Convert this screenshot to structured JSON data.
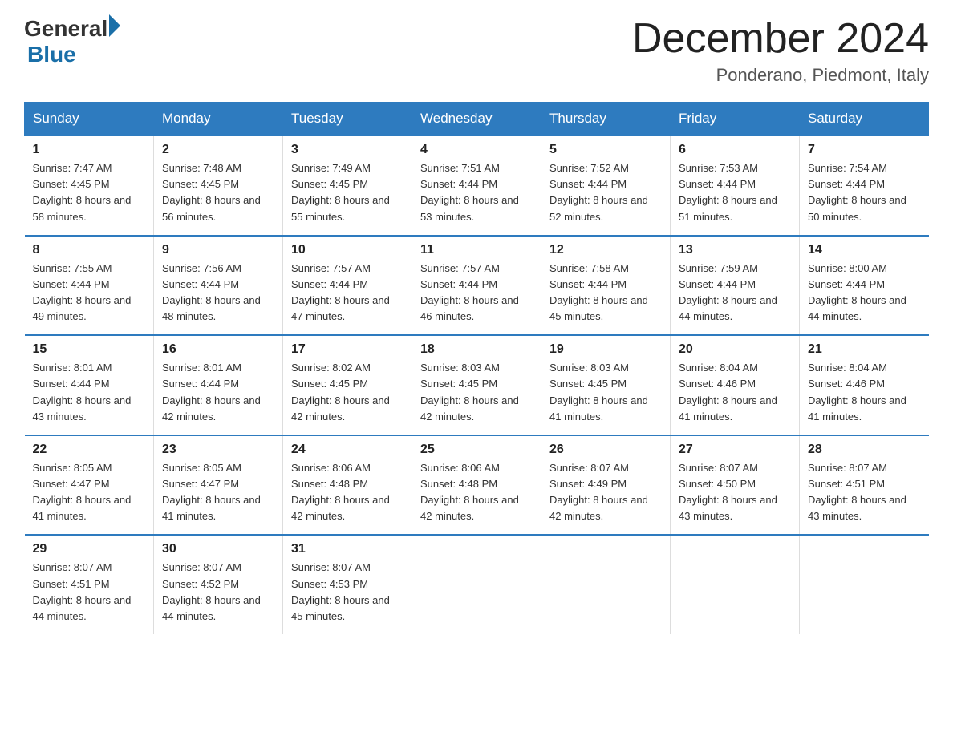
{
  "logo": {
    "general": "General",
    "blue": "Blue"
  },
  "title": "December 2024",
  "location": "Ponderano, Piedmont, Italy",
  "headers": [
    "Sunday",
    "Monday",
    "Tuesday",
    "Wednesday",
    "Thursday",
    "Friday",
    "Saturday"
  ],
  "weeks": [
    [
      {
        "day": "1",
        "sunrise": "7:47 AM",
        "sunset": "4:45 PM",
        "daylight": "8 hours and 58 minutes."
      },
      {
        "day": "2",
        "sunrise": "7:48 AM",
        "sunset": "4:45 PM",
        "daylight": "8 hours and 56 minutes."
      },
      {
        "day": "3",
        "sunrise": "7:49 AM",
        "sunset": "4:45 PM",
        "daylight": "8 hours and 55 minutes."
      },
      {
        "day": "4",
        "sunrise": "7:51 AM",
        "sunset": "4:44 PM",
        "daylight": "8 hours and 53 minutes."
      },
      {
        "day": "5",
        "sunrise": "7:52 AM",
        "sunset": "4:44 PM",
        "daylight": "8 hours and 52 minutes."
      },
      {
        "day": "6",
        "sunrise": "7:53 AM",
        "sunset": "4:44 PM",
        "daylight": "8 hours and 51 minutes."
      },
      {
        "day": "7",
        "sunrise": "7:54 AM",
        "sunset": "4:44 PM",
        "daylight": "8 hours and 50 minutes."
      }
    ],
    [
      {
        "day": "8",
        "sunrise": "7:55 AM",
        "sunset": "4:44 PM",
        "daylight": "8 hours and 49 minutes."
      },
      {
        "day": "9",
        "sunrise": "7:56 AM",
        "sunset": "4:44 PM",
        "daylight": "8 hours and 48 minutes."
      },
      {
        "day": "10",
        "sunrise": "7:57 AM",
        "sunset": "4:44 PM",
        "daylight": "8 hours and 47 minutes."
      },
      {
        "day": "11",
        "sunrise": "7:57 AM",
        "sunset": "4:44 PM",
        "daylight": "8 hours and 46 minutes."
      },
      {
        "day": "12",
        "sunrise": "7:58 AM",
        "sunset": "4:44 PM",
        "daylight": "8 hours and 45 minutes."
      },
      {
        "day": "13",
        "sunrise": "7:59 AM",
        "sunset": "4:44 PM",
        "daylight": "8 hours and 44 minutes."
      },
      {
        "day": "14",
        "sunrise": "8:00 AM",
        "sunset": "4:44 PM",
        "daylight": "8 hours and 44 minutes."
      }
    ],
    [
      {
        "day": "15",
        "sunrise": "8:01 AM",
        "sunset": "4:44 PM",
        "daylight": "8 hours and 43 minutes."
      },
      {
        "day": "16",
        "sunrise": "8:01 AM",
        "sunset": "4:44 PM",
        "daylight": "8 hours and 42 minutes."
      },
      {
        "day": "17",
        "sunrise": "8:02 AM",
        "sunset": "4:45 PM",
        "daylight": "8 hours and 42 minutes."
      },
      {
        "day": "18",
        "sunrise": "8:03 AM",
        "sunset": "4:45 PM",
        "daylight": "8 hours and 42 minutes."
      },
      {
        "day": "19",
        "sunrise": "8:03 AM",
        "sunset": "4:45 PM",
        "daylight": "8 hours and 41 minutes."
      },
      {
        "day": "20",
        "sunrise": "8:04 AM",
        "sunset": "4:46 PM",
        "daylight": "8 hours and 41 minutes."
      },
      {
        "day": "21",
        "sunrise": "8:04 AM",
        "sunset": "4:46 PM",
        "daylight": "8 hours and 41 minutes."
      }
    ],
    [
      {
        "day": "22",
        "sunrise": "8:05 AM",
        "sunset": "4:47 PM",
        "daylight": "8 hours and 41 minutes."
      },
      {
        "day": "23",
        "sunrise": "8:05 AM",
        "sunset": "4:47 PM",
        "daylight": "8 hours and 41 minutes."
      },
      {
        "day": "24",
        "sunrise": "8:06 AM",
        "sunset": "4:48 PM",
        "daylight": "8 hours and 42 minutes."
      },
      {
        "day": "25",
        "sunrise": "8:06 AM",
        "sunset": "4:48 PM",
        "daylight": "8 hours and 42 minutes."
      },
      {
        "day": "26",
        "sunrise": "8:07 AM",
        "sunset": "4:49 PM",
        "daylight": "8 hours and 42 minutes."
      },
      {
        "day": "27",
        "sunrise": "8:07 AM",
        "sunset": "4:50 PM",
        "daylight": "8 hours and 43 minutes."
      },
      {
        "day": "28",
        "sunrise": "8:07 AM",
        "sunset": "4:51 PM",
        "daylight": "8 hours and 43 minutes."
      }
    ],
    [
      {
        "day": "29",
        "sunrise": "8:07 AM",
        "sunset": "4:51 PM",
        "daylight": "8 hours and 44 minutes."
      },
      {
        "day": "30",
        "sunrise": "8:07 AM",
        "sunset": "4:52 PM",
        "daylight": "8 hours and 44 minutes."
      },
      {
        "day": "31",
        "sunrise": "8:07 AM",
        "sunset": "4:53 PM",
        "daylight": "8 hours and 45 minutes."
      },
      null,
      null,
      null,
      null
    ]
  ]
}
